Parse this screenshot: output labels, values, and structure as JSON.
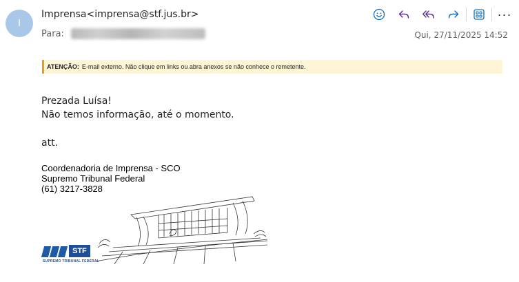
{
  "header": {
    "avatar_initial": "I",
    "sender": "Imprensa<imprensa@stf.jus.br>",
    "to_label": "Para:",
    "date": "Qui, 27/11/2025 14:52"
  },
  "toolbar": {
    "icons": [
      "emoji-icon",
      "reply-icon",
      "reply-all-icon",
      "forward-icon",
      "apps-icon",
      "more-icon"
    ],
    "more_label": "···",
    "accent": "#5c2d91",
    "blue": "#0f6cbd"
  },
  "banner": {
    "label": "ATENÇÃO:",
    "text": "E-mail externo. Não clique em links ou abra anexos se não conhece o remetente.",
    "bg": "#fdf5d6",
    "border": "#e3a21a"
  },
  "message": {
    "greeting": "Prezada Luísa!",
    "line1": "Não temos informação, até o momento.",
    "closing": "att."
  },
  "signature": {
    "line1": "Coordenadoria de Imprensa - SCO",
    "line2": "Supremo Tribunal Federal",
    "line3": "(61) 3217-3828"
  },
  "logo": {
    "box_text": "STF",
    "subtitle": "SUPREMO TRIBUNAL FEDERAL"
  }
}
